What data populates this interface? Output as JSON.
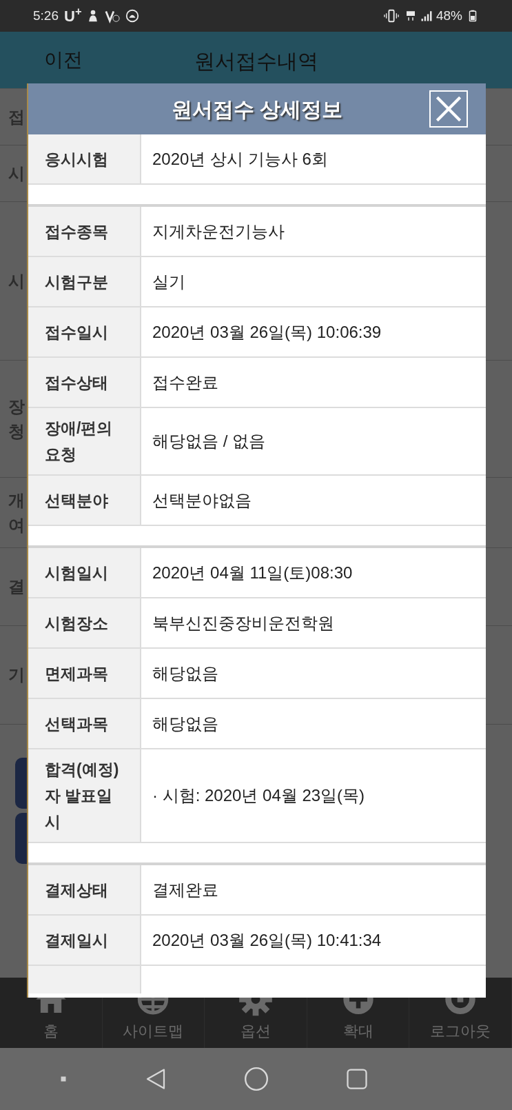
{
  "status_bar": {
    "time": "5:26",
    "carrier": "U$^{+}$",
    "battery": "48%"
  },
  "header": {
    "back": "이전",
    "title": "원서접수내역"
  },
  "background_labels": [
    [
      "접"
    ],
    [
      "시"
    ],
    [
      "시"
    ],
    [
      "장",
      "청"
    ],
    [
      "개",
      "여"
    ],
    [
      "결"
    ],
    [
      "기"
    ]
  ],
  "modal": {
    "title": "원서접수 상세정보",
    "sections": [
      [
        {
          "label": [
            "응시시험"
          ],
          "value": "2020년 상시 기능사 6회"
        }
      ],
      [
        {
          "label": [
            "접수종목"
          ],
          "value": "지게차운전기능사"
        },
        {
          "label": [
            "시험구분"
          ],
          "value": "실기"
        },
        {
          "label": [
            "접수일시"
          ],
          "value": "2020년 03월 26일(목) 10:06:39"
        },
        {
          "label": [
            "접수상태"
          ],
          "value": "접수완료"
        },
        {
          "label": [
            "장애/편의",
            "요청"
          ],
          "value": "해당없음 / 없음"
        },
        {
          "label": [
            "선택분야"
          ],
          "value": "선택분야없음"
        }
      ],
      [
        {
          "label": [
            "시험일시"
          ],
          "value": "2020년 04월 11일(토)08:30"
        },
        {
          "label": [
            "시험장소"
          ],
          "value": "북부신진중장비운전학원"
        },
        {
          "label": [
            "면제과목"
          ],
          "value": "해당없음"
        },
        {
          "label": [
            "선택과목"
          ],
          "value": "해당없음"
        },
        {
          "label": [
            "합격(예정)",
            "자 발표일",
            "시"
          ],
          "value": "· 시험: 2020년 04월 23일(목)"
        }
      ],
      [
        {
          "label": [
            "결제상태"
          ],
          "value": "결제완료"
        },
        {
          "label": [
            "결제일시"
          ],
          "value": "2020년 03월 26일(목) 10:41:34"
        }
      ]
    ]
  },
  "bottom_nav": [
    {
      "kind": "home",
      "label": "홈"
    },
    {
      "kind": "globe",
      "label": "사이트맵"
    },
    {
      "kind": "gear",
      "label": "옵션"
    },
    {
      "kind": "plus",
      "label": "확대"
    },
    {
      "kind": "logout",
      "label": "로그아웃"
    }
  ]
}
